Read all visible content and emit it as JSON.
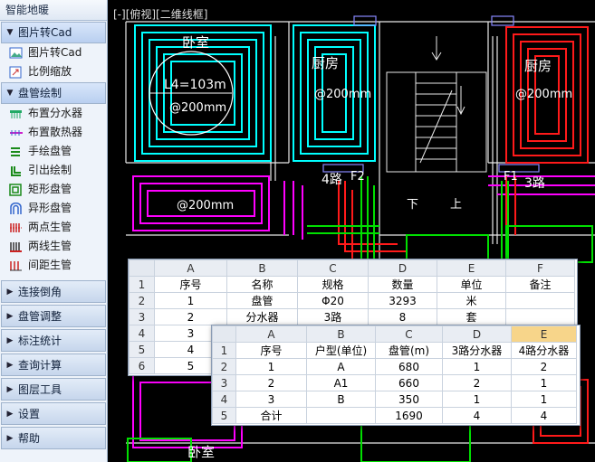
{
  "sidebar": {
    "title": "智能地暖",
    "groups": [
      {
        "label": "图片转Cad",
        "open": true,
        "items": [
          "图片转Cad",
          "比例缩放"
        ]
      },
      {
        "label": "盘管绘制",
        "open": true,
        "items": [
          "布置分水器",
          "布置散热器",
          "手绘盘管",
          "引出绘制",
          "矩形盘管",
          "异形盘管",
          "两点生管",
          "两线生管",
          "间距生管"
        ]
      }
    ],
    "collapsed": [
      "连接倒角",
      "盘管调整",
      "标注统计",
      "查询计算",
      "图层工具",
      "设置",
      "帮助"
    ]
  },
  "canvas": {
    "view_label": "[-][俯视][二维线框]",
    "rooms": {
      "left_room": "卧室",
      "mid_room": "厨房",
      "right_room": "厨房",
      "bottom_room": "卧室"
    },
    "labels": {
      "length": "L4=103m",
      "spacing": "@200mm",
      "loop4": "4路",
      "f2": "F2",
      "f1": "F1",
      "loop3": "3路",
      "down": "下",
      "up": "上"
    },
    "colors": {
      "cyan": "#00ffff",
      "magenta": "#ff00ff",
      "red": "#ff1a1a",
      "green": "#00e000",
      "white": "#ffffff"
    }
  },
  "table1": {
    "cols": [
      "A",
      "B",
      "C",
      "D",
      "E",
      "F"
    ],
    "rows": [
      [
        "序号",
        "名称",
        "规格",
        "数量",
        "单位",
        "备注"
      ],
      [
        "1",
        "盘管",
        "Φ20",
        "3293",
        "米",
        ""
      ],
      [
        "2",
        "分水器",
        "3路",
        "8",
        "套",
        ""
      ],
      [
        "3",
        "",
        "",
        "",
        "",
        ""
      ],
      [
        "4",
        "",
        "",
        "",
        "",
        ""
      ],
      [
        "5",
        "",
        "",
        "",
        "",
        ""
      ]
    ]
  },
  "table2": {
    "cols": [
      "A",
      "B",
      "C",
      "D",
      "E"
    ],
    "rows": [
      [
        "序号",
        "户型(单位)",
        "盘管(m)",
        "3路分水器",
        "4路分水器"
      ],
      [
        "1",
        "A",
        "680",
        "1",
        "2"
      ],
      [
        "2",
        "A1",
        "660",
        "2",
        "1"
      ],
      [
        "3",
        "B",
        "350",
        "1",
        "1"
      ],
      [
        "合计",
        "",
        "1690",
        "4",
        "4"
      ]
    ]
  }
}
